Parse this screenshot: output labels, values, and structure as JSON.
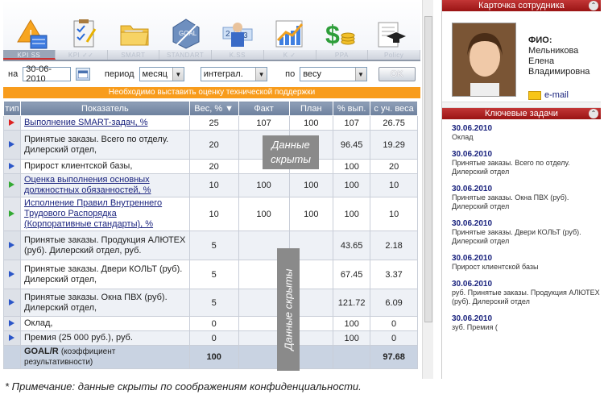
{
  "icon_tabs": [
    "KPI SS",
    "KPI ✓✓",
    "SMART",
    "STANDART",
    "K.SS",
    "K ✓",
    "PPA",
    "Policy"
  ],
  "filters": {
    "date_label": "на",
    "date_value": "30-06-2010",
    "period_label": "период",
    "period_value": "месяц",
    "mode_value": "интеграл.",
    "by_label": "по",
    "by_value": "весу",
    "ok_label": "OK"
  },
  "banner": "Необходимо выставить оценку технической поддержки",
  "table": {
    "headers": [
      "тип",
      "Показатель",
      "Вес, %",
      "Факт",
      "План",
      "% вып.",
      "с уч. веса"
    ],
    "rows": [
      {
        "name": "Выполнение SMART-задач, %",
        "link": true,
        "marker": "red",
        "weight": "25",
        "fact": "107",
        "plan": "100",
        "pct": "107",
        "weighted": "26.75"
      },
      {
        "name": "Принятые заказы. Всего по отделу. Дилерский отдел,",
        "link": false,
        "marker": "blue",
        "weight": "20",
        "fact": "",
        "plan": "",
        "pct": "96.45",
        "weighted": "19.29"
      },
      {
        "name": "Прирост клиентской базы,",
        "link": false,
        "marker": "blue",
        "weight": "20",
        "fact": "",
        "plan": "",
        "pct": "100",
        "weighted": "20"
      },
      {
        "name": "Оценка выполнения основных должностных обязанностей, %",
        "link": true,
        "marker": "green",
        "weight": "10",
        "fact": "100",
        "plan": "100",
        "pct": "100",
        "weighted": "10"
      },
      {
        "name": "Исполнение Правил Внутреннего Трудового Распорядка (Корпоративные стандарты), %",
        "link": true,
        "marker": "green",
        "weight": "10",
        "fact": "100",
        "plan": "100",
        "pct": "100",
        "weighted": "10"
      },
      {
        "name": "Принятые заказы. Продукция АЛЮТЕХ (руб). Дилерский отдел, руб.",
        "link": false,
        "marker": "blue",
        "weight": "5",
        "fact": "",
        "plan": "",
        "pct": "43.65",
        "weighted": "2.18"
      },
      {
        "name": "Принятые заказы. Двери КОЛЬТ (руб). Дилерский отдел,",
        "link": false,
        "marker": "blue",
        "weight": "5",
        "fact": "",
        "plan": "",
        "pct": "67.45",
        "weighted": "3.37"
      },
      {
        "name": "Принятые заказы. Окна ПВХ (руб). Дилерский отдел,",
        "link": false,
        "marker": "blue",
        "weight": "5",
        "fact": "",
        "plan": "",
        "pct": "121.72",
        "weighted": "6.09"
      },
      {
        "name": "Оклад,",
        "link": false,
        "marker": "blue",
        "weight": "0",
        "fact": "",
        "plan": "",
        "pct": "100",
        "weighted": "0"
      },
      {
        "name": "Премия (25 000 руб.), руб.",
        "link": false,
        "marker": "blue",
        "weight": "0",
        "fact": "",
        "plan": "",
        "pct": "100",
        "weighted": "0"
      }
    ],
    "total": {
      "label": "GOAL/R",
      "label_note": "(коэффициент результативности)",
      "weight": "100",
      "weighted": "97.68"
    }
  },
  "hidden_overlay_1": "Данные скрыты",
  "hidden_overlay_2": "Данные скрыты",
  "employee_card": {
    "title": "Карточка сотрудника",
    "fio_label": "ФИО:",
    "last_name": "Мельникова",
    "first_name": "Елена",
    "middle_name": "Владимировна",
    "email_label": "e-mail"
  },
  "key_tasks": {
    "title": "Ключевые задачи",
    "items": [
      {
        "date": "30.06.2010",
        "text": "Оклад"
      },
      {
        "date": "30.06.2010",
        "text": "Принятые заказы. Всего по отделу. Дилерский отдел"
      },
      {
        "date": "30.06.2010",
        "text": "Принятые заказы. Окна ПВХ (руб). Дилерский отдел"
      },
      {
        "date": "30.06.2010",
        "text": "Принятые заказы. Двери КОЛЬТ (руб). Дилерский отдел"
      },
      {
        "date": "30.06.2010",
        "text": "Прирост клиентской базы"
      },
      {
        "date": "30.06.2010",
        "text": "руб. Принятые заказы. Продукция АЛЮТЕХ (руб). Дилерский отдел"
      },
      {
        "date": "30.06.2010",
        "text": "зуб. Премия ("
      }
    ]
  },
  "footnote": "* Примечание: данные скрыты по соображениям конфиденциальности."
}
